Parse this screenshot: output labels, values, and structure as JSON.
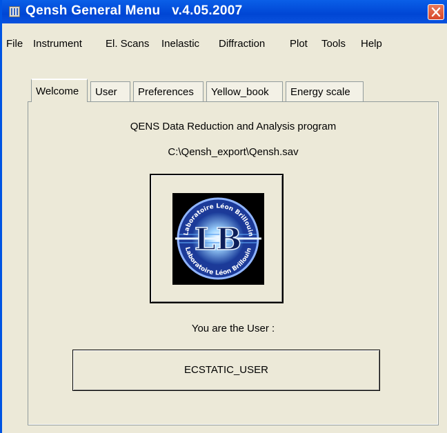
{
  "window": {
    "title": "Qensh General Menu   v.4.05.2007",
    "close_label": "Close"
  },
  "menu": [
    "File",
    "Instrument",
    "El. Scans",
    "Inelastic",
    "Diffraction",
    "Plot",
    "Tools",
    "Help"
  ],
  "tabs": [
    {
      "label": "Welcome",
      "active": true
    },
    {
      "label": "User",
      "active": false
    },
    {
      "label": "Preferences",
      "active": false
    },
    {
      "label": "Yellow_book",
      "active": false
    },
    {
      "label": "Energy scale",
      "active": false
    }
  ],
  "welcome": {
    "program_title": "QENS Data Reduction and Analysis program",
    "save_path": "C:\\Qensh_export\\Qensh.sav",
    "logo": {
      "ring_text": "Laboratoire Léon Brillouin",
      "monogram": "LB"
    },
    "user_prompt": "You are the User :",
    "user_name": "ECSTATIC_USER"
  },
  "colors": {
    "titlebar": "#0054e3",
    "close_button": "#d8472a",
    "window_bg": "#ece9d8",
    "logo_ring": "#2a4fb0"
  }
}
